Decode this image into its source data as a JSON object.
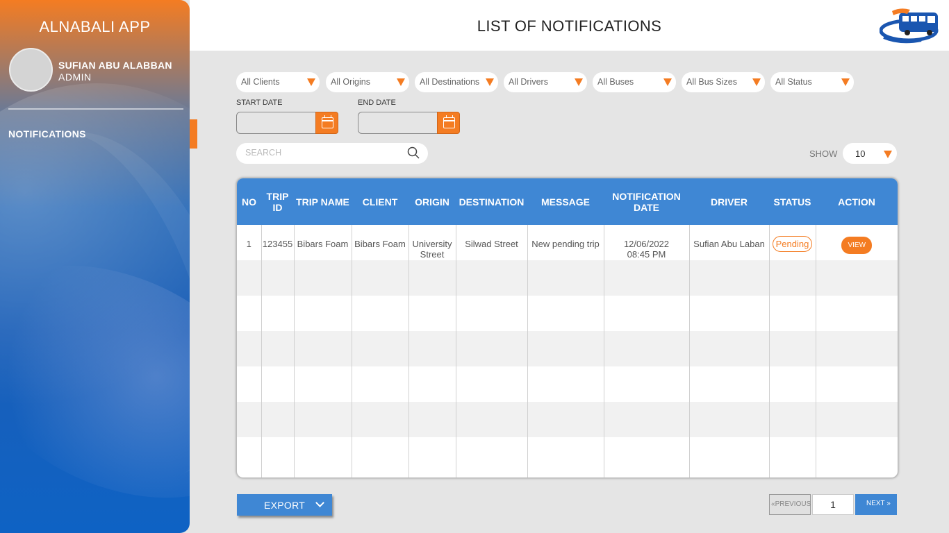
{
  "sidebar": {
    "app_title": "ALNABALI APP",
    "user_name": "SUFIAN ABU ALABBAN",
    "user_role": "ADMIN",
    "nav_item": "NOTIFICATIONS"
  },
  "header": {
    "title": "LIST OF NOTIFICATIONS"
  },
  "filters": [
    "All Clients",
    "All Origins",
    "All Destinations",
    "All Drivers",
    "All Buses",
    "All Bus Sizes",
    "All Status"
  ],
  "dates": {
    "start_label": "START DATE",
    "end_label": "END DATE"
  },
  "search": {
    "placeholder": "SEARCH"
  },
  "show": {
    "label": "SHOW",
    "value": "10"
  },
  "table": {
    "headers": [
      "NO",
      "TRIP ID",
      "TRIP NAME",
      "CLIENT",
      "ORIGIN",
      "DESTINATION",
      "MESSAGE",
      "NOTIFICATION DATE",
      "DRIVER",
      "STATUS",
      "ACTION"
    ],
    "rows": [
      {
        "no": "1",
        "trip_id": "123455",
        "trip_name": "Bibars Foam",
        "client": "Bibars Foam",
        "origin": "University Street",
        "destination": "Silwad Street",
        "message": "New pending trip",
        "date": "12/06/2022",
        "time": "08:45 PM",
        "driver": "Sufian Abu Laban",
        "status": "Pending",
        "action": "VIEW"
      }
    ]
  },
  "export": {
    "label": "EXPORT"
  },
  "pagination": {
    "previous": "PREVIOUS",
    "page": "1",
    "next": "NEXT"
  },
  "colors": {
    "accent": "#f47c22",
    "primary": "#3f87d4"
  }
}
